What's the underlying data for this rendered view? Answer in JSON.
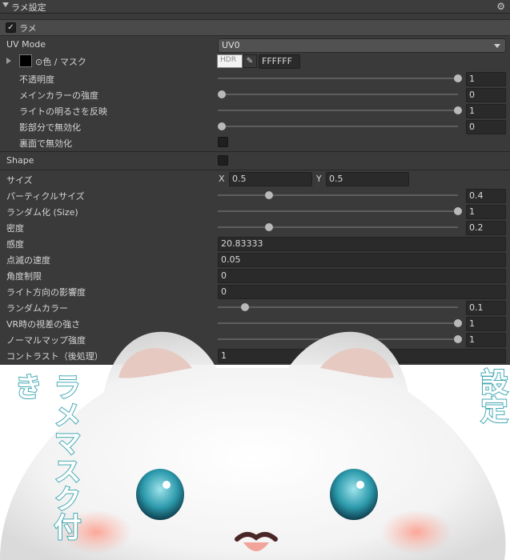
{
  "panel": {
    "title": "ラメ設定"
  },
  "foldout": {
    "label": "ラメ",
    "checked": true
  },
  "uv_mode": {
    "label": "UV Mode",
    "value": "UV0"
  },
  "color_mask": {
    "label": "⊙色 / マスク",
    "hdr": "HDR",
    "hex": "FFFFFF"
  },
  "rows_a": [
    {
      "label": "不透明度",
      "value": "1",
      "fraction": 1.0
    },
    {
      "label": "メインカラーの強度",
      "value": "0",
      "fraction": 0.0
    },
    {
      "label": "ライトの明るさを反映",
      "value": "1",
      "fraction": 1.0
    },
    {
      "label": "影部分で無効化",
      "value": "0",
      "fraction": 0.0
    }
  ],
  "backface": {
    "label": "裏面で無効化",
    "checked": false
  },
  "shape": {
    "label": "Shape",
    "checked": false
  },
  "size": {
    "label": "サイズ",
    "x_label": "X",
    "x": "0.5",
    "y_label": "Y",
    "y": "0.5"
  },
  "rows_b": [
    {
      "label": "パーティクルサイズ",
      "value": "0.4",
      "fraction": 0.2
    },
    {
      "label": "ランダム化 (Size)",
      "value": "1",
      "fraction": 1.0
    },
    {
      "label": "密度",
      "value": "0.2",
      "fraction": 0.2
    }
  ],
  "fields": [
    {
      "label": "感度",
      "value": "20.83333"
    },
    {
      "label": "点滅の速度",
      "value": "0.05"
    },
    {
      "label": "角度制限",
      "value": "0"
    },
    {
      "label": "ライト方向の影響度",
      "value": "0"
    }
  ],
  "rows_c": [
    {
      "label": "ランダムカラー",
      "value": "0.1",
      "fraction": 0.1
    },
    {
      "label": "VR時の視差の強さ",
      "value": "1",
      "fraction": 1.0
    },
    {
      "label": "ノーマルマップ強度",
      "value": "1",
      "fraction": 1.0
    }
  ],
  "contrast": {
    "label": "コントラスト（後処理）",
    "value": "1"
  },
  "promo": {
    "left_text": "ラメマスク付き",
    "right_text": "おすすめラメ設定",
    "outline_color": "#44aab5"
  }
}
